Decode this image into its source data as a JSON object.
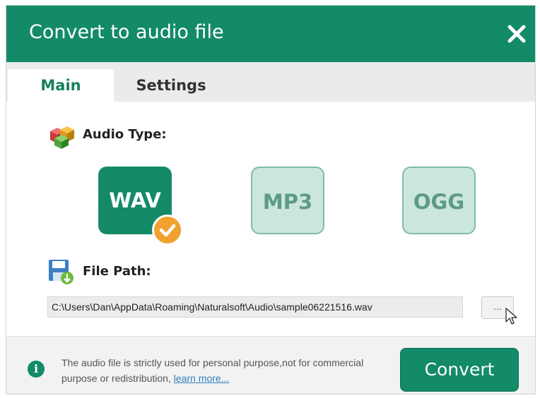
{
  "dialog": {
    "title": "Convert to audio file",
    "close_icon": "close-icon"
  },
  "tabs": [
    {
      "label": "Main",
      "active": true
    },
    {
      "label": "Settings",
      "active": false
    }
  ],
  "audio_type": {
    "label": "Audio Type:",
    "icon": "cubes-icon",
    "formats": [
      {
        "label": "WAV",
        "selected": true
      },
      {
        "label": "MP3",
        "selected": false
      },
      {
        "label": "OGG",
        "selected": false
      }
    ]
  },
  "file_path": {
    "label": "File Path:",
    "icon": "save-disk-icon",
    "value": "C:\\Users\\Dan\\AppData\\Roaming\\Naturalsoft\\Audio\\sample06221516.wav",
    "browse_label": "..."
  },
  "footer": {
    "notice_text": "The audio file is strictly used for personal purpose,not for commercial purpose or redistribution,",
    "learn_more": "learn more...",
    "convert_label": "Convert"
  },
  "colors": {
    "primary": "#138a68",
    "selected_check": "#f0a12e",
    "unselected_fill": "#cbe6de",
    "link": "#2f7fbe"
  }
}
